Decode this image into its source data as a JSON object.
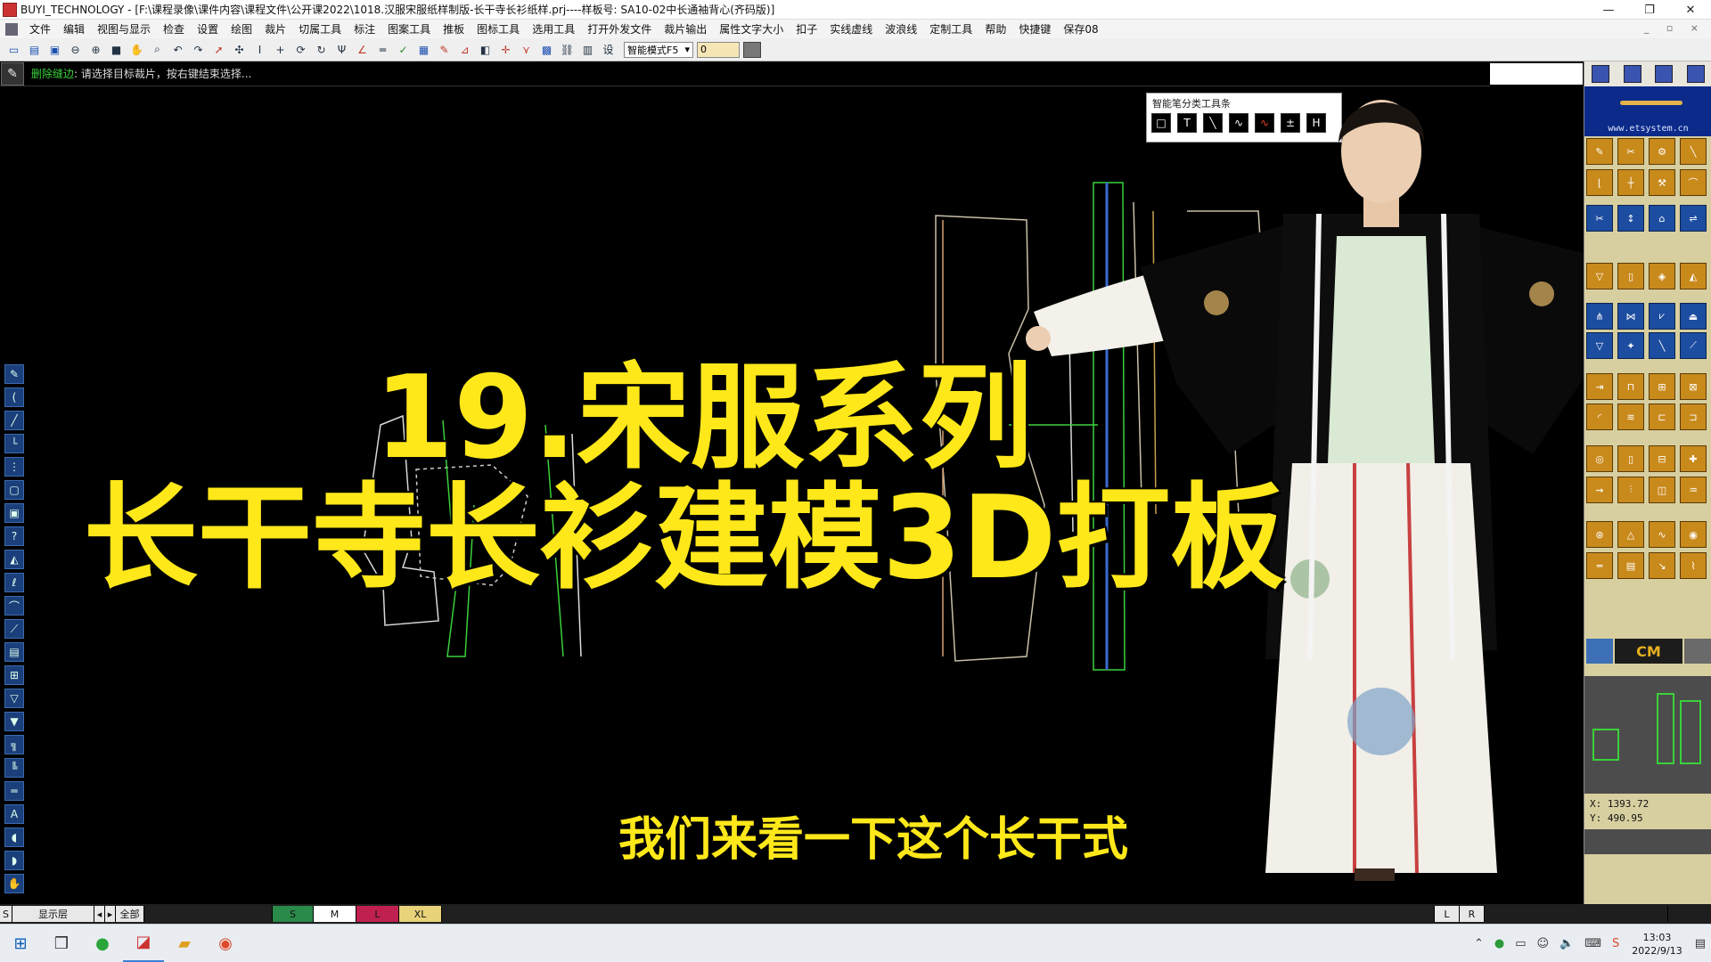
{
  "window": {
    "title": "BUYI_TECHNOLOGY - [F:\\课程录像\\课件内容\\课程文件\\公开课2022\\1018.汉服宋服纸样制版-长干寺长衫纸样.prj----样板号: SA10-02中长通袖背心(齐码版)]",
    "controls": [
      "—",
      "❐",
      "✕"
    ]
  },
  "menu": {
    "items": [
      "文件",
      "编辑",
      "视图与显示",
      "检查",
      "设置",
      "绘图",
      "裁片",
      "切属工具",
      "标注",
      "图案工具",
      "推板",
      "图标工具",
      "选用工具",
      "打开外发文件",
      "裁片输出",
      "属性文字大小",
      "扣子",
      "实线虚线",
      "波浪线",
      "定制工具",
      "帮助",
      "快捷键",
      "保存08"
    ],
    "mdi_controls": "_ ▫ ×"
  },
  "toolbar": {
    "mode_select": "智能模式F5",
    "value_input": "0"
  },
  "hint": {
    "label": "删除缝边",
    "text": ": 请选择目标裁片，按右键结束选择..."
  },
  "smart_toolbar": {
    "title": "智能笔分类工具条",
    "tools": [
      "□",
      "T",
      "╲",
      "∿",
      "∿",
      "±",
      "H"
    ]
  },
  "overlay": {
    "title_line1": "19.宋服系列",
    "title_line2": "长干寺长衫建模3D打板",
    "subtitle": "我们来看一下这个长干式"
  },
  "right_panel": {
    "logo_text": "www.etsystem.cn",
    "unit": "CM",
    "coord_x": "X:  1393.72",
    "coord_y": "Y:  490.95"
  },
  "size_bar": {
    "left_label": "S",
    "layer_label": "显示层",
    "all_label": "全部",
    "sizes": [
      {
        "label": "S",
        "color": "#2a8a4a"
      },
      {
        "label": "M",
        "color": "#ffffff"
      },
      {
        "label": "L",
        "color": "#c02050"
      },
      {
        "label": "XL",
        "color": "#e8d27a"
      }
    ],
    "right_labels": [
      "L",
      "R"
    ]
  },
  "taskbar": {
    "time": "13:03",
    "date": "2022/9/13"
  },
  "colors": {
    "accent_yellow": "#ffe81a",
    "canvas_bg": "#000000",
    "panel_gold": "#d8cfa0",
    "hint_green": "#3ad13a"
  }
}
